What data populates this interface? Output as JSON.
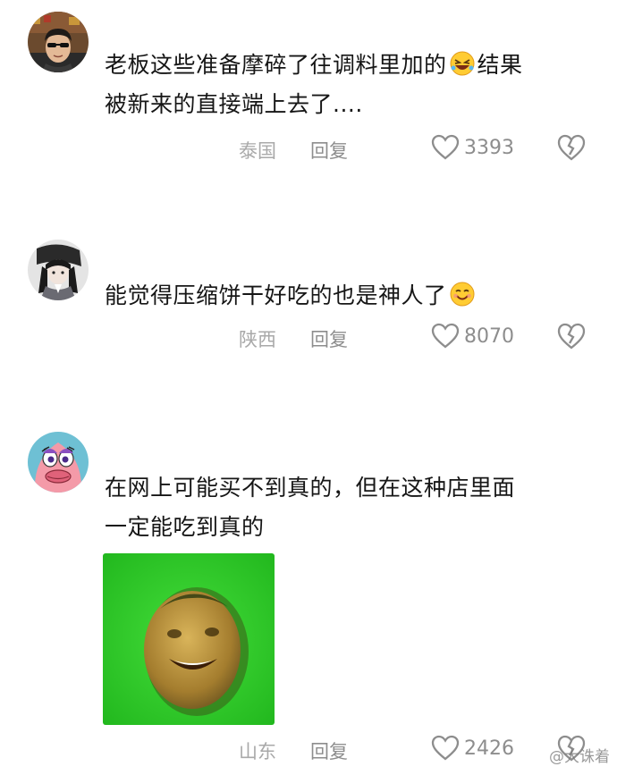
{
  "comments": [
    {
      "avatar": "avatar-man-sunglasses",
      "lines": [
        "老板这些准备摩碎了往调料里加的",
        "被新来的直接端上去了...."
      ],
      "line1_tail": "结果",
      "emoji": "rolling-laughing-emoji",
      "location": "泰国",
      "reply": "回复",
      "likes": "3393"
    },
    {
      "avatar": "avatar-anime-girl",
      "lines": [
        "能觉得压缩饼干好吃的也是神人了"
      ],
      "emoji": "smiling-emoji",
      "location": "陕西",
      "reply": "回复",
      "likes": "8070"
    },
    {
      "avatar": "avatar-patrick-star",
      "lines": [
        "在网上可能买不到真的，但在这种店里面",
        "一定能吃到真的"
      ],
      "attachment": "green-screen-laughing-potato-image",
      "location": "山东",
      "reply": "回复",
      "likes": "2426"
    }
  ],
  "icons": {
    "like": "heart-outline-icon",
    "dislike": "broken-heart-icon"
  },
  "watermark": "@大诛着",
  "colors": {
    "text": "#161616",
    "meta": "#9a9a9a",
    "attachment_bg": "#2fcf2a"
  }
}
